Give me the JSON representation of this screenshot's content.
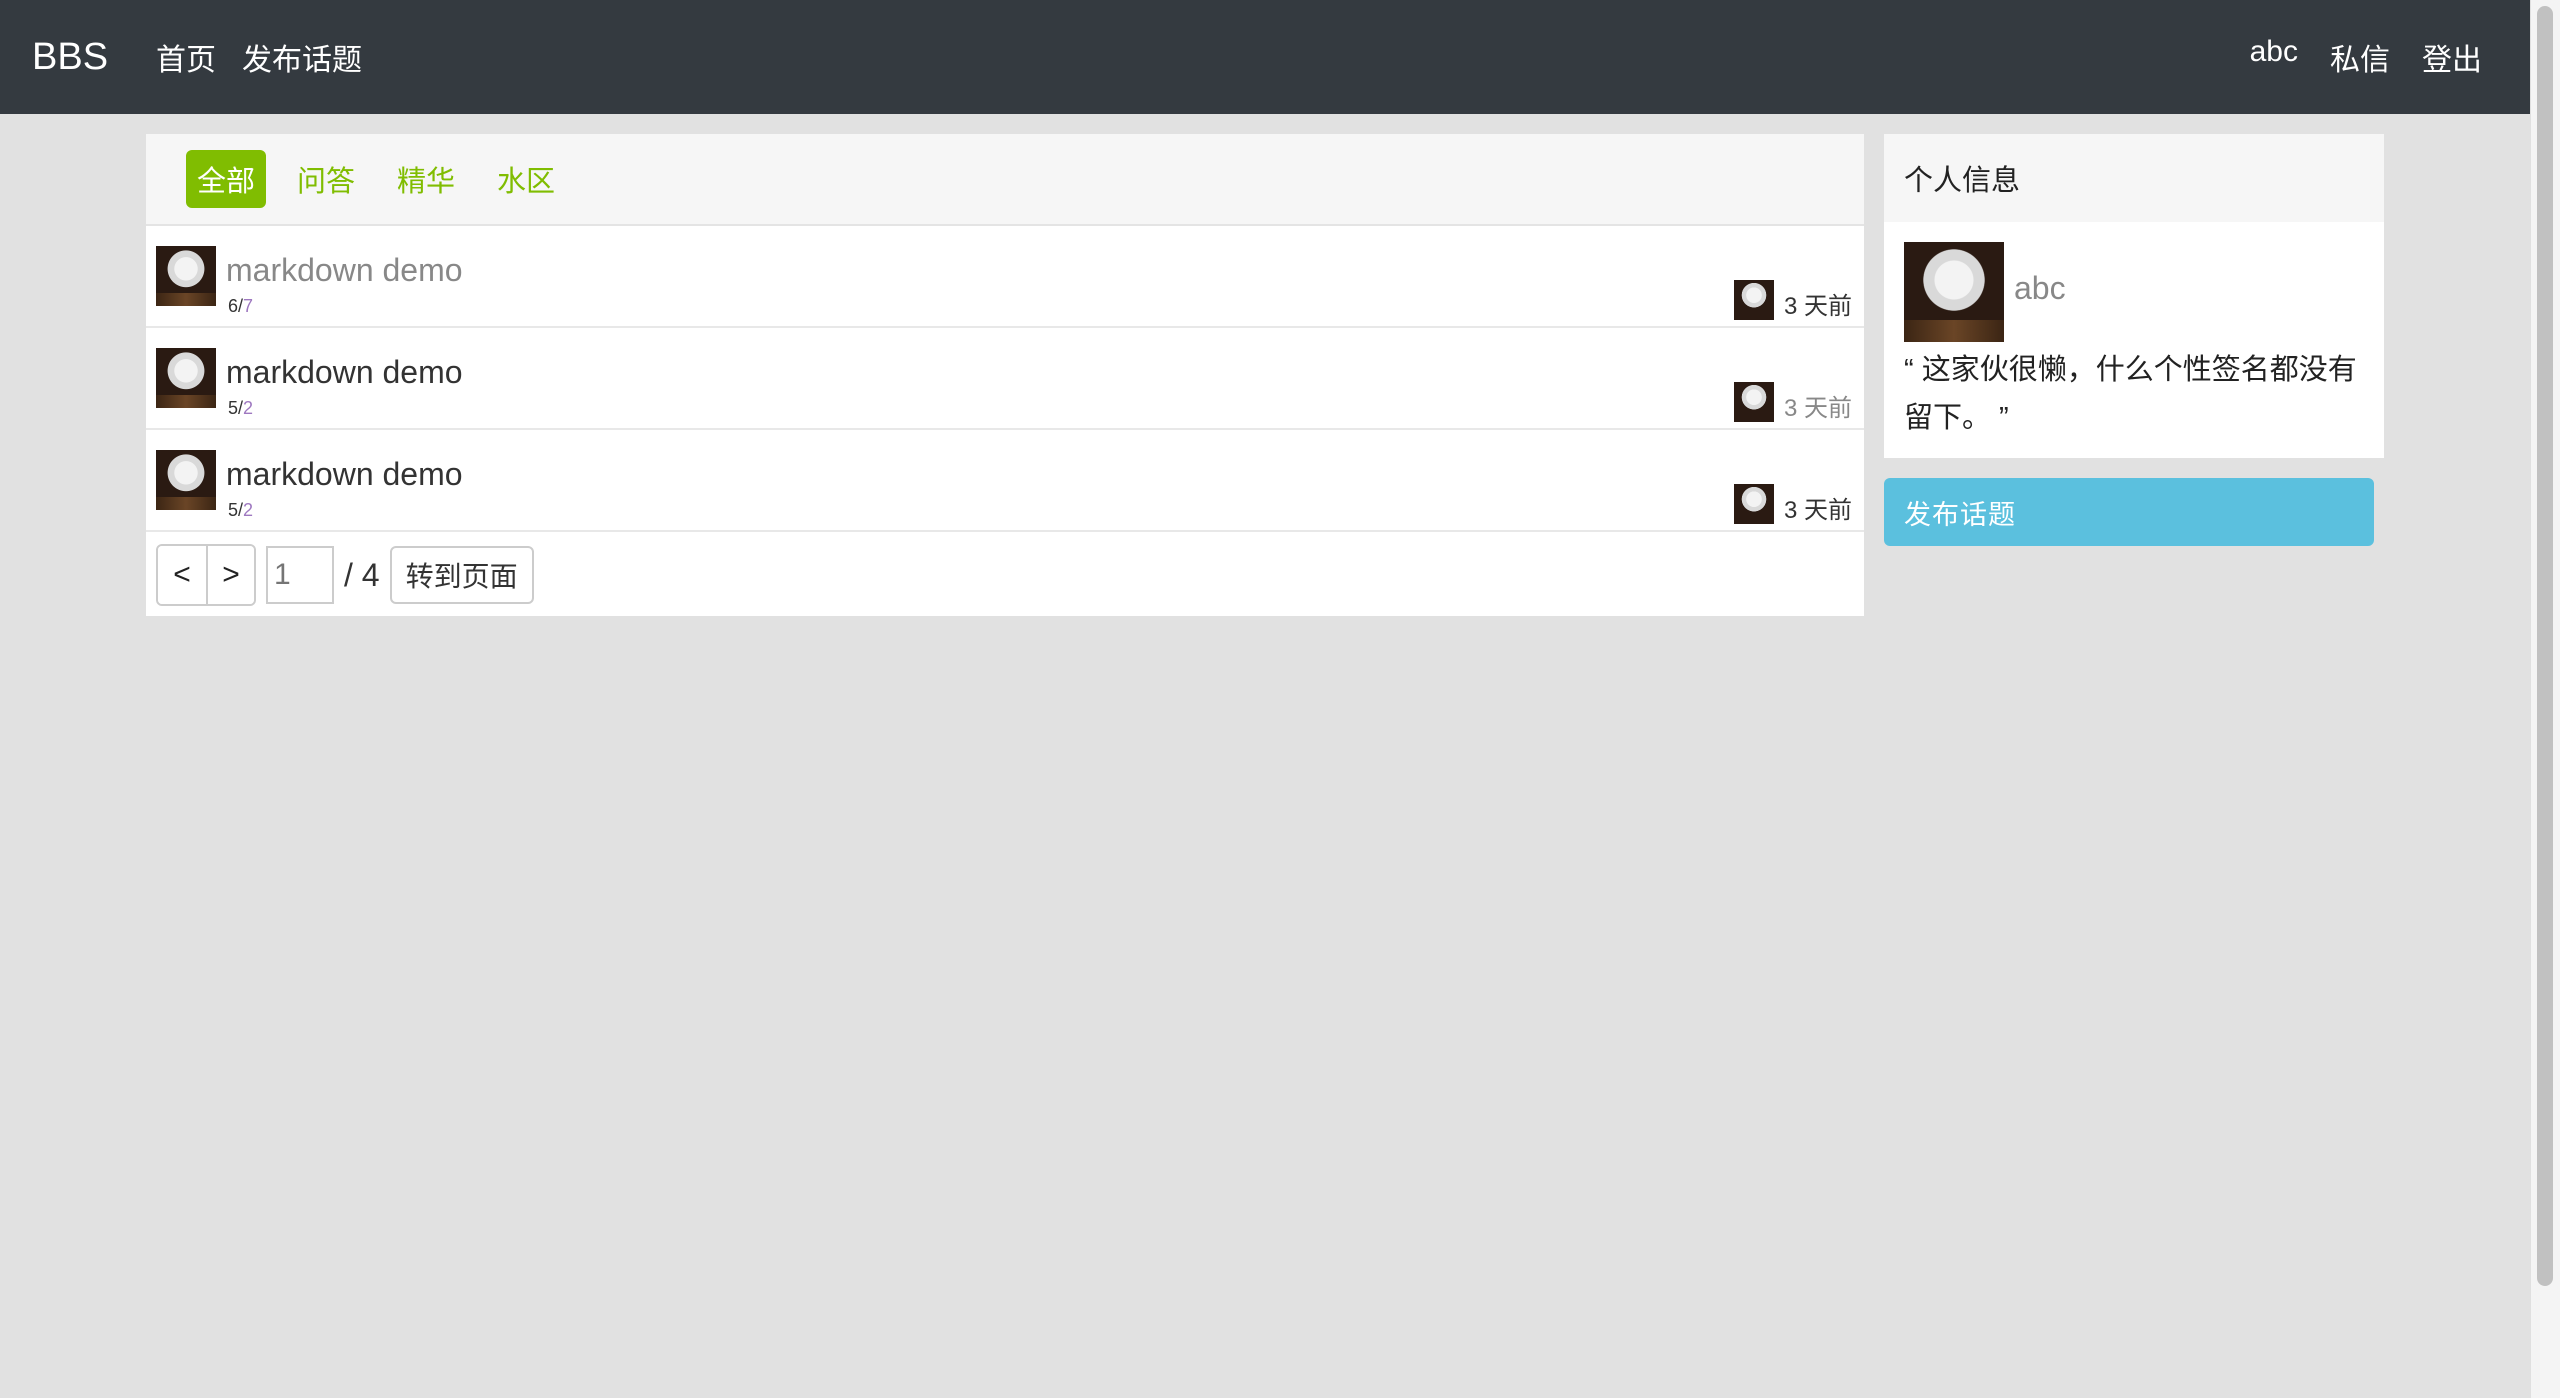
{
  "navbar": {
    "brand": "BBS",
    "left_links": [
      "首页",
      "发布话题"
    ],
    "right_links": [
      "abc",
      "私信",
      "登出"
    ]
  },
  "tabs": [
    {
      "label": "全部",
      "active": true
    },
    {
      "label": "问答",
      "active": false
    },
    {
      "label": "精华",
      "active": false
    },
    {
      "label": "水区",
      "active": false
    }
  ],
  "topics": [
    {
      "title": "markdown demo",
      "replies": "6",
      "views": "7",
      "time": "3 天前"
    },
    {
      "title": "markdown demo",
      "replies": "5",
      "views": "2",
      "time": "3 天前"
    },
    {
      "title": "markdown demo",
      "replies": "5",
      "views": "2",
      "time": "3 天前"
    }
  ],
  "pager": {
    "prev": "<",
    "next": ">",
    "page_input": "1",
    "total": "/ 4",
    "goto": "转到页面"
  },
  "profile": {
    "header": "个人信息",
    "username": "abc",
    "signature": "“ 这家伙很懒，什么个性签名都没有留下。 ”"
  },
  "sidebar_button": "发布话题",
  "colors": {
    "navbar_bg": "#343a40",
    "accent_green": "#80bd01",
    "post_button": "#5bc0de",
    "page_bg": "#e1e1e1"
  }
}
